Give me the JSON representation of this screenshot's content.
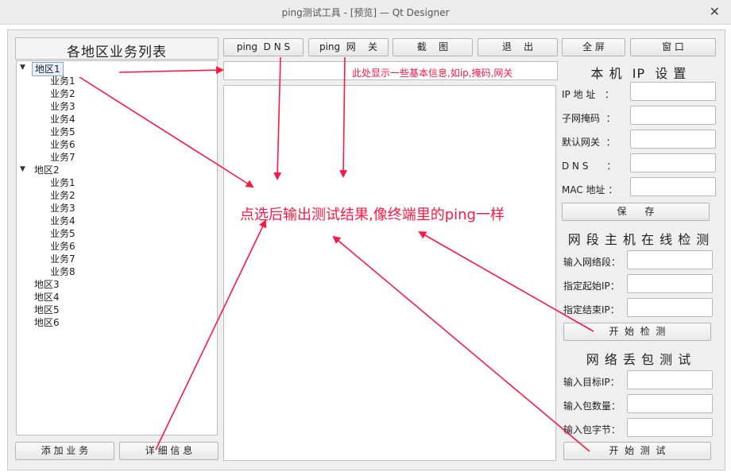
{
  "window": {
    "title": "ping测试工具 - [预览] — Qt Designer",
    "close": "✕"
  },
  "toolbar": {
    "ping_dns": "ping  D N S",
    "ping_gateway": "ping  网    关",
    "screenshot": "截    图",
    "exit": "退    出",
    "fullscreen": "全 屏",
    "window": "窗 口"
  },
  "left": {
    "title": "各地区业务列表",
    "tree": [
      {
        "label": "地区1",
        "children": [
          "业务1",
          "业务2",
          "业务3",
          "业务4",
          "业务5",
          "业务6",
          "业务7"
        ]
      },
      {
        "label": "地区2",
        "children": [
          "业务1",
          "业务2",
          "业务3",
          "业务4",
          "业务5",
          "业务6",
          "业务7",
          "业务8"
        ]
      },
      {
        "label": "地区3",
        "children": []
      },
      {
        "label": "地区4",
        "children": []
      },
      {
        "label": "地区5",
        "children": []
      },
      {
        "label": "地区6",
        "children": []
      }
    ],
    "add_btn": "添 加 业 务",
    "detail_btn": "详 细 信 息"
  },
  "center": {
    "info_text": "此处显示一些基本信息,如ip,掩码,网关",
    "output_text": "点选后输出测试结果,像终端里的ping一样"
  },
  "ipsettings": {
    "title": "本 机  IP  设 置",
    "ip": "IP 地 址   ：",
    "mask": "子网掩码  ：",
    "gateway": "默认网关  ：",
    "dns": "D N S      ：",
    "mac": "MAC 地址 ：",
    "save": "保      存"
  },
  "scan": {
    "title": "网 段 主 机 在 线 检 测",
    "segment": "输入网络段：",
    "start_ip": "指定起始IP：",
    "end_ip": "指定结束IP：",
    "start_btn": "开  始  检  测"
  },
  "loss": {
    "title": "网 络 丢 包 测 试",
    "target": "输入目标IP：",
    "count": "输入包数量：",
    "bytes": "输入包字节：",
    "start_btn": "开  始  测  试"
  },
  "colors": {
    "annotation": "#ff1744"
  }
}
